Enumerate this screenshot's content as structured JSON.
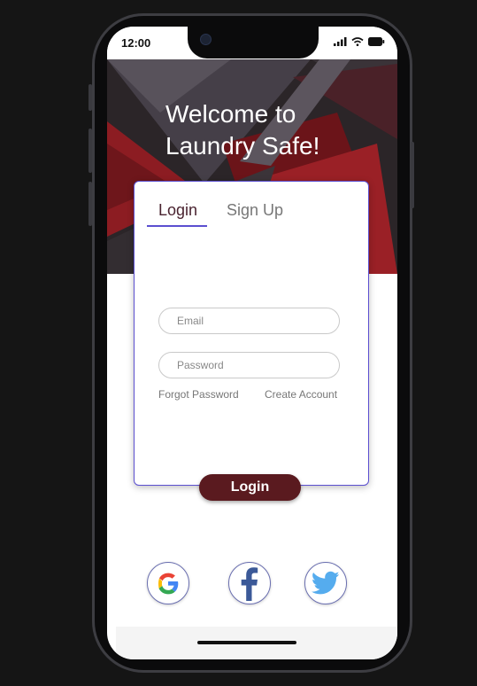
{
  "status_bar": {
    "time": "12:00"
  },
  "hero": {
    "line1": "Welcome to",
    "line2": "Laundry Safe!"
  },
  "tabs": {
    "login": "Login",
    "signup": "Sign Up",
    "active": "login"
  },
  "form": {
    "email_placeholder": "Email",
    "email_value": "",
    "password_placeholder": "Password",
    "password_value": "",
    "forgot_password": "Forgot Password",
    "create_account": "Create Account"
  },
  "login_button": "Login",
  "social": [
    "google-icon",
    "facebook-icon",
    "twitter-icon"
  ],
  "colors": {
    "accent": "#5b4fd0",
    "login_button": "#5a1a1f",
    "hero_red": "#8c1c22",
    "facebook": "#3b5998",
    "twitter": "#55acee"
  }
}
